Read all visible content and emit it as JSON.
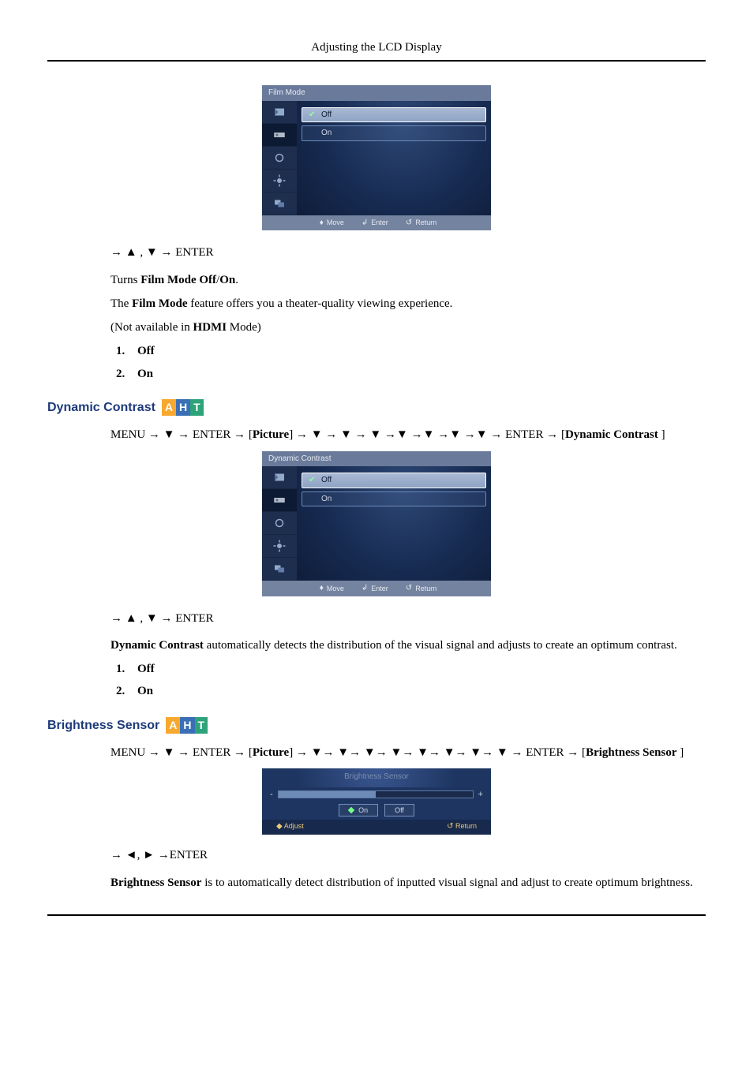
{
  "page": {
    "header": "Adjusting the LCD Display"
  },
  "film_mode": {
    "osd_title": "Film Mode",
    "options": [
      {
        "label": "Off",
        "selected": true
      },
      {
        "label": "On",
        "selected": false
      }
    ],
    "footer": {
      "move": "Move",
      "enter": "Enter",
      "return": "Return"
    },
    "nav1": "→ ▲ , ▼ → ENTER",
    "desc_prefix": "Turns ",
    "desc_bold": "Film Mode Off",
    "desc_mid": "/",
    "desc_bold2": "On",
    "desc_suffix": ".",
    "line2_pre": "The ",
    "line2_bold": "Film Mode",
    "line2_post": " feature offers you a theater-quality viewing experience.",
    "line3_pre": "(Not available in ",
    "line3_bold": "HDMI",
    "line3_post": " Mode)",
    "list": [
      "Off",
      "On"
    ]
  },
  "dynamic_contrast": {
    "heading": "Dynamic Contrast",
    "menu_path_pre": "MENU → ▼ → ENTER → [",
    "menu_path_bold1": "Picture",
    "menu_path_mid": "] → ▼ → ▼ → ▼ →▼ →▼ →▼ →▼ → ENTER → [",
    "menu_path_bold2": "Dynamic Contrast",
    "menu_path_post": " ]",
    "osd_title": "Dynamic Contrast",
    "options": [
      {
        "label": "Off",
        "selected": true
      },
      {
        "label": "On",
        "selected": false
      }
    ],
    "footer": {
      "move": "Move",
      "enter": "Enter",
      "return": "Return"
    },
    "nav1": "→ ▲ , ▼ → ENTER",
    "desc_bold": "Dynamic Contrast",
    "desc_post": " automatically detects the distribution of the visual signal and adjusts to create an optimum contrast.",
    "list": [
      "Off",
      "On"
    ]
  },
  "brightness_sensor": {
    "heading": "Brightness Sensor",
    "menu_path_pre": "MENU → ▼ → ENTER → [",
    "menu_path_bold1": "Picture",
    "menu_path_mid": "] → ▼→ ▼→ ▼→ ▼→ ▼→ ▼→ ▼→ ▼ → ENTER → [",
    "menu_path_bold2": "Brightness Sensor",
    "menu_path_post": " ]",
    "osd_title": "Brightness Sensor",
    "bar_minus": "-",
    "bar_plus": "+",
    "btn_on": "On",
    "btn_off": "Off",
    "footer_adjust": "Adjust",
    "footer_return": "Return",
    "nav1": "→ ◄, ► →ENTER",
    "desc_bold": "Brightness Sensor",
    "desc_post": " is to automatically detect distribution of inputted visual signal and adjust to create optimum brightness."
  }
}
